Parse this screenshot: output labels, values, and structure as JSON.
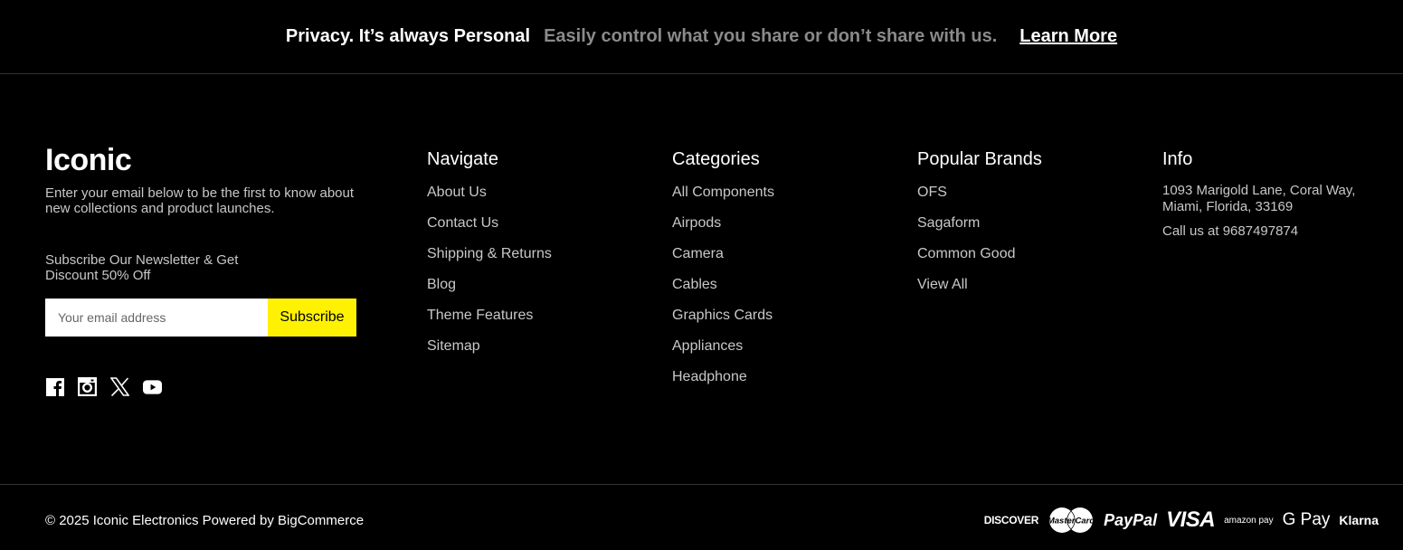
{
  "privacy": {
    "title": "Privacy. It’s always Personal",
    "description": "Easily control what you share or don’t share with us.",
    "link": "Learn More"
  },
  "brand": {
    "logo": "Iconic",
    "description": "Enter your email below to be the first to know about new collections and product launches.",
    "newsletter_text": "Subscribe Our Newsletter & Get Discount 50% Off",
    "email_placeholder": "Your email address",
    "subscribe_label": "Subscribe",
    "social_icons": [
      "facebook-icon",
      "instagram-icon",
      "x-icon",
      "youtube-icon"
    ]
  },
  "navigate": {
    "title": "Navigate",
    "items": [
      "About Us",
      "Contact Us",
      "Shipping & Returns",
      "Blog",
      "Theme Features",
      "Sitemap"
    ]
  },
  "categories": {
    "title": "Categories",
    "items": [
      "All Components",
      "Airpods",
      "Camera",
      "Cables",
      "Graphics Cards",
      "Appliances",
      "Headphone"
    ]
  },
  "brands": {
    "title": "Popular Brands",
    "items": [
      "OFS",
      "Sagaform",
      "Common Good",
      "View All"
    ]
  },
  "info": {
    "title": "Info",
    "address": "1093 Marigold Lane, Coral Way, Miami, Florida, 33169",
    "phone": "Call us at 9687497874"
  },
  "bottom": {
    "copyright": "© 2025 Iconic Electronics Powered by BigCommerce",
    "payments": {
      "discover": "DISCOVER",
      "mastercard": "MasterCard",
      "paypal": "PayPal",
      "visa": "VISA",
      "amazonpay": "amazon pay",
      "gpay": "G Pay",
      "klarna": "Klarna"
    }
  },
  "colors": {
    "background": "#000000",
    "accent": "#fff200",
    "muted_text": "#8a8a8a"
  }
}
